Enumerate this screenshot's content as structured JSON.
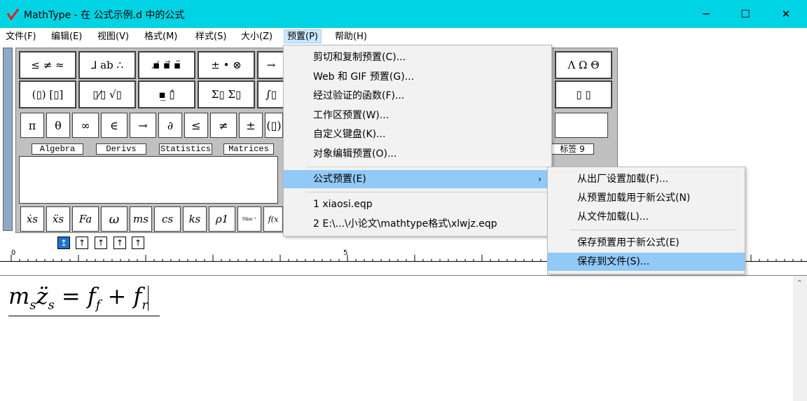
{
  "window": {
    "title": "MathType - 在 公式示例.d 中的公式"
  },
  "menubar": {
    "items": [
      "文件(F)",
      "编辑(E)",
      "视图(V)",
      "格式(M)",
      "样式(S)",
      "大小(Z)",
      "预置(P)",
      "帮助(H)"
    ]
  },
  "palette": {
    "row1": [
      "≤ ≠ ≈",
      "⅃ ab ∴",
      "▪̸ ▪⃗ ▪̈",
      "± • ⊗",
      "→",
      "Λ Ω Θ"
    ],
    "row2": [
      "(▯) [▯]",
      "▯⁄▯ √▯",
      "▪̲ ▯̂",
      "Σ▯ Σ▯",
      "∫▯",
      "▯ ▯"
    ],
    "row3": [
      "π",
      "θ",
      "∞",
      "∈",
      "→",
      "∂",
      "≤",
      "≠",
      "±",
      "(▯)"
    ],
    "tabs": [
      "Algebra",
      "Derivs",
      "Statistics",
      "Matrices",
      "标签 9"
    ],
    "row4": [
      "ẋs",
      "ẍs",
      "Fa",
      "ω",
      "ms",
      "cs",
      "ks",
      "ρ1",
      "Nkm⁻¹",
      "f(x"
    ]
  },
  "preset_menu": {
    "items": [
      "剪切和复制预置(C)...",
      "Web 和 GIF 预置(G)...",
      "经过验证的函数(F)...",
      "工作区预置(W)...",
      "自定义键盘(K)...",
      "对象编辑预置(O)...",
      "公式预置(E)",
      "1 xiaosi.eqp",
      "2 E:\\...\\小论文\\mathtype格式\\xlwjz.eqp"
    ],
    "submenu_arrow": "›"
  },
  "formula_submenu": {
    "items": [
      "从出厂设置加载(F)...",
      "从预置加载用于新公式(N)",
      "从文件加载(L)...",
      "保存预置用于新公式(E)",
      "保存到文件(S)..."
    ]
  },
  "ruler": {
    "marks": [
      "0",
      "5"
    ],
    "buttons": [
      "↥",
      "↑",
      "↑",
      "↑",
      "↑"
    ]
  },
  "editor": {
    "formula": {
      "m": "m",
      "s1": "s",
      "z": "z̈",
      "s2": "s",
      "eq": " = ",
      "f1": "f",
      "sub1": "f",
      "plus": " + ",
      "f2": "f",
      "sub2": "r"
    }
  }
}
